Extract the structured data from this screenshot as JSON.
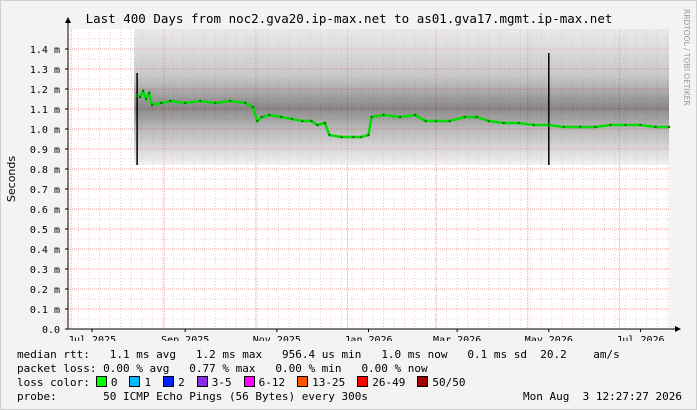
{
  "chart_data": {
    "type": "line",
    "title": "Last 400 Days from noc2.gva20.ip-max.net to as01.gva17.mgmt.ip-max.net",
    "ylabel": "Seconds",
    "watermark": "RRDTOOL / TOBI OETIKER",
    "ylim": [
      0,
      0.0015
    ],
    "y_ticks": [
      {
        "v": 0,
        "label": "0.0"
      },
      {
        "v": 0.0001,
        "label": "0.1 m"
      },
      {
        "v": 0.0002,
        "label": "0.2 m"
      },
      {
        "v": 0.0003,
        "label": "0.3 m"
      },
      {
        "v": 0.0004,
        "label": "0.4 m"
      },
      {
        "v": 0.0005,
        "label": "0.5 m"
      },
      {
        "v": 0.0006,
        "label": "0.6 m"
      },
      {
        "v": 0.0007,
        "label": "0.7 m"
      },
      {
        "v": 0.0008,
        "label": "0.8 m"
      },
      {
        "v": 0.0009,
        "label": "0.9 m"
      },
      {
        "v": 0.001,
        "label": "1.0 m"
      },
      {
        "v": 0.0011,
        "label": "1.1 m"
      },
      {
        "v": 0.0012,
        "label": "1.2 m"
      },
      {
        "v": 0.0013,
        "label": "1.3 m"
      },
      {
        "v": 0.0014,
        "label": "1.4 m"
      }
    ],
    "x_range": [
      "2025-06-29",
      "2026-08-03"
    ],
    "x_ticks": [
      {
        "date": "2025-07-15",
        "label": "Jul 2025"
      },
      {
        "date": "2025-09-15",
        "label": "Sep 2025"
      },
      {
        "date": "2025-11-15",
        "label": "Nov 2025"
      },
      {
        "date": "2026-01-15",
        "label": "Jan 2026"
      },
      {
        "date": "2026-03-15",
        "label": "Mar 2026"
      },
      {
        "date": "2026-05-15",
        "label": "May 2026"
      },
      {
        "date": "2026-07-15",
        "label": "Jul 2026"
      }
    ],
    "grid": true,
    "series": [
      {
        "name": "median rtt",
        "color": "#00dd00",
        "points": [
          [
            "2025-08-14",
            0.00117
          ],
          [
            "2025-08-16",
            0.00116
          ],
          [
            "2025-08-18",
            0.00119
          ],
          [
            "2025-08-20",
            0.00115
          ],
          [
            "2025-08-22",
            0.00118
          ],
          [
            "2025-08-24",
            0.00112
          ],
          [
            "2025-08-30",
            0.00113
          ],
          [
            "2025-09-05",
            0.00114
          ],
          [
            "2025-09-15",
            0.00113
          ],
          [
            "2025-09-25",
            0.00114
          ],
          [
            "2025-10-05",
            0.00113
          ],
          [
            "2025-10-15",
            0.00114
          ],
          [
            "2025-10-25",
            0.00113
          ],
          [
            "2025-10-30",
            0.00111
          ],
          [
            "2025-11-02",
            0.00104
          ],
          [
            "2025-11-05",
            0.00106
          ],
          [
            "2025-11-10",
            0.00107
          ],
          [
            "2025-11-18",
            0.00106
          ],
          [
            "2025-11-25",
            0.00105
          ],
          [
            "2025-12-02",
            0.00104
          ],
          [
            "2025-12-08",
            0.00104
          ],
          [
            "2025-12-12",
            0.00102
          ],
          [
            "2025-12-17",
            0.00103
          ],
          [
            "2025-12-20",
            0.00097
          ],
          [
            "2025-12-28",
            0.00096
          ],
          [
            "2026-01-05",
            0.00096
          ],
          [
            "2026-01-10",
            0.00096
          ],
          [
            "2026-01-15",
            0.00097
          ],
          [
            "2026-01-17",
            0.00106
          ],
          [
            "2026-01-25",
            0.00107
          ],
          [
            "2026-02-05",
            0.00106
          ],
          [
            "2026-02-15",
            0.00107
          ],
          [
            "2026-02-22",
            0.00104
          ],
          [
            "2026-03-01",
            0.00104
          ],
          [
            "2026-03-10",
            0.00104
          ],
          [
            "2026-03-20",
            0.00106
          ],
          [
            "2026-03-28",
            0.00106
          ],
          [
            "2026-04-05",
            0.00104
          ],
          [
            "2026-04-15",
            0.00103
          ],
          [
            "2026-04-25",
            0.00103
          ],
          [
            "2026-05-05",
            0.00102
          ],
          [
            "2026-05-15",
            0.00102
          ],
          [
            "2026-05-25",
            0.00101
          ],
          [
            "2026-06-05",
            0.00101
          ],
          [
            "2026-06-15",
            0.00101
          ],
          [
            "2026-06-25",
            0.00102
          ],
          [
            "2026-07-05",
            0.00102
          ],
          [
            "2026-07-15",
            0.00102
          ],
          [
            "2026-07-25",
            0.00101
          ],
          [
            "2026-08-03",
            0.00101
          ]
        ]
      }
    ],
    "smoke": {
      "start": "2025-08-12",
      "lower": 0.00082,
      "upper": 0.0015,
      "spikes": [
        {
          "date": "2025-08-14",
          "top": 0.00128
        },
        {
          "date": "2026-05-15",
          "top": 0.00138
        }
      ]
    }
  },
  "stats": {
    "median_rtt": {
      "label": "median rtt:",
      "avg": "1.1 ms avg",
      "max": "1.2 ms max",
      "min": "956.4 us min",
      "now": "1.0 ms now",
      "sd": "0.1 ms sd",
      "am": "20.2",
      "am_unit": "am/s"
    },
    "packet_loss": {
      "label": "packet loss:",
      "avg": "0.00 % avg",
      "max": "0.77 % max",
      "min": "0.00 % min",
      "now": "0.00 % now"
    },
    "loss_color": {
      "label": "loss color:",
      "items": [
        {
          "label": "0",
          "color": "#00ff00"
        },
        {
          "label": "1",
          "color": "#00bbff"
        },
        {
          "label": "2",
          "color": "#0022ff"
        },
        {
          "label": "3-5",
          "color": "#8a2be2"
        },
        {
          "label": "6-12",
          "color": "#ff00ff"
        },
        {
          "label": "13-25",
          "color": "#ff5500"
        },
        {
          "label": "26-49",
          "color": "#ff0000"
        },
        {
          "label": "50/50",
          "color": "#a10000"
        }
      ]
    },
    "probe": {
      "label": "probe:",
      "desc": "50 ICMP Echo Pings (56 Bytes) every 300s",
      "timestamp": "Mon Aug  3 12:27:27 2026"
    }
  }
}
